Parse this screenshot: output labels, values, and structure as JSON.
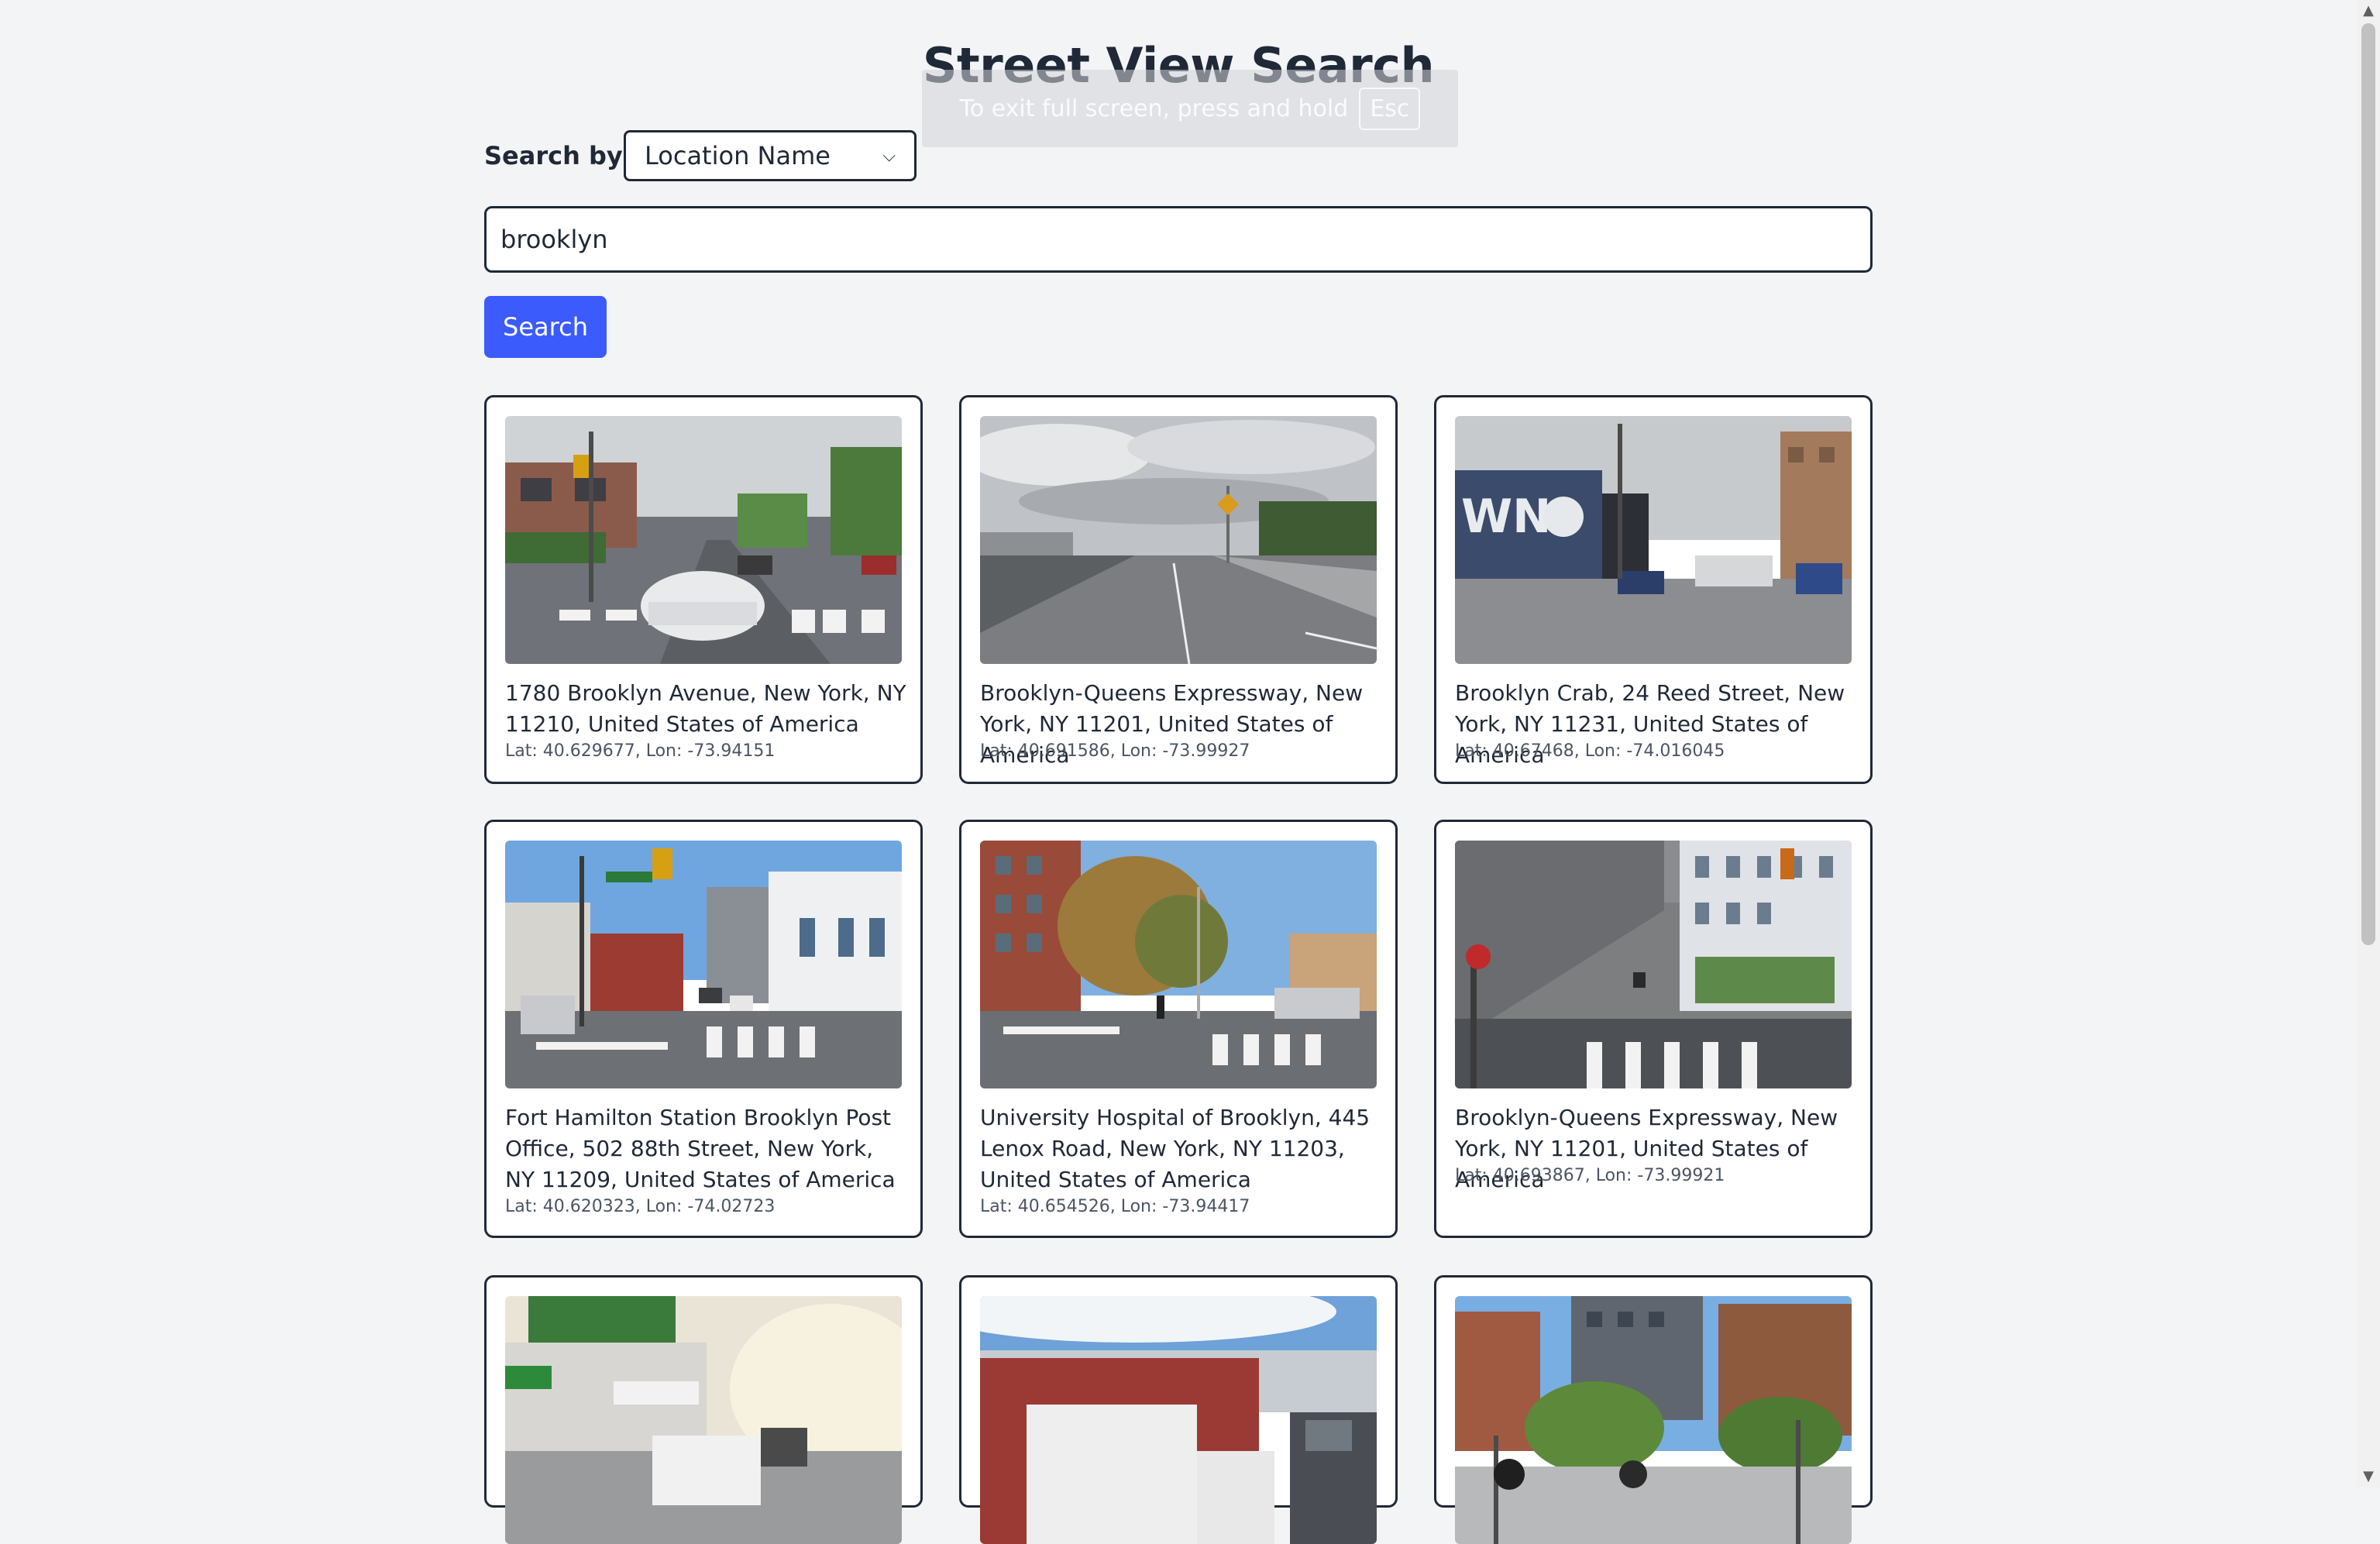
{
  "header": {
    "title": "Street View Search"
  },
  "fullscreen_notice": {
    "text": "To exit full screen, press and hold",
    "key": "Esc"
  },
  "search": {
    "by_label": "Search by:",
    "by_value": "Location Name",
    "query": "brooklyn",
    "button_label": "Search"
  },
  "results": [
    {
      "name": "1780 Brooklyn Avenue, New York, NY 11210, United States of America",
      "coords": "Lat: 40.629677, Lon: -73.94151"
    },
    {
      "name": "Brooklyn-Queens Expressway, New York, NY 11201, United States of America",
      "coords": "Lat: 40.691586, Lon: -73.99927"
    },
    {
      "name": "Brooklyn Crab, 24 Reed Street, New York, NY 11231, United States of America",
      "coords": "Lat: 40.67468, Lon: -74.016045"
    },
    {
      "name": "Fort Hamilton Station Brooklyn Post Office, 502 88th Street, New York, NY 11209, United States of America",
      "coords": "Lat: 40.620323, Lon: -74.02723"
    },
    {
      "name": "University Hospital of Brooklyn, 445 Lenox Road, New York, NY 11203, United States of America",
      "coords": "Lat: 40.654526, Lon: -73.94417"
    },
    {
      "name": "Brooklyn-Queens Expressway, New York, NY 11201, United States of America",
      "coords": "Lat: 40.693867, Lon: -73.99921"
    },
    {
      "name": "",
      "coords": ""
    },
    {
      "name": "",
      "coords": ""
    },
    {
      "name": "",
      "coords": ""
    }
  ],
  "colors": {
    "accent": "#3b5bfd",
    "background": "#f3f4f6",
    "text": "#1f2937"
  }
}
